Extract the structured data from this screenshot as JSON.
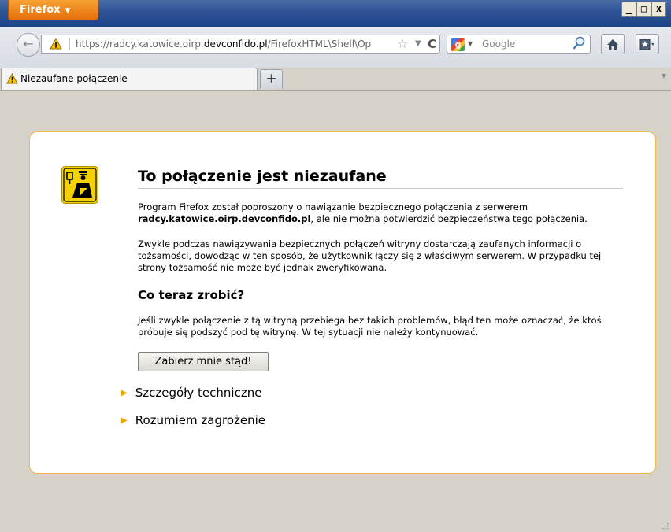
{
  "window": {
    "app_button_label": "Firefox",
    "controls": {
      "minimize": "_",
      "maximize": "□",
      "close": "x"
    }
  },
  "navbar": {
    "url_prefix": "https://radcy.katowice.oirp.",
    "url_host": "devconfido.pl",
    "url_suffix": "/FirefoxHTML\\Shell\\Op",
    "search_engine": "Google",
    "search_placeholder": "Google"
  },
  "tabs": [
    {
      "label": "Niezaufane połączenie",
      "active": true
    }
  ],
  "new_tab_label": "+",
  "error_page": {
    "title": "To połączenie jest niezaufane",
    "intro_before": "Program Firefox został poproszony o nawiązanie bezpiecznego połączenia z serwerem",
    "intro_host": "radcy.katowice.oirp.devconfido.pl",
    "intro_after": ", ale nie można potwierdzić bezpieczeństwa tego połączenia.",
    "explanation": "Zwykle podczas nawiązywania bezpiecznych połączeń witryny dostarczają zaufanych informacji o tożsamości, dowodząc w ten sposób, że użytkownik łączy się z właściwym serwerem. W przypadku tej strony tożsamość nie może być jednak zweryfikowana.",
    "what_to_do_heading": "Co teraz zrobić?",
    "what_to_do_text": "Jeśli zwykle połączenie z tą witryną przebiega bez takich problemów, błąd ten może oznaczać, że ktoś próbuje się podszyć pod tę witrynę. W tej sytuacji nie należy kontynuować.",
    "get_me_out_button": "Zabierz mnie stąd!",
    "technical_details": "Szczegóły techniczne",
    "understand_risks": "Rozumiem zagrożenie"
  },
  "colors": {
    "accent": "#f0a400",
    "box_border": "#f1b849",
    "firefox_button": "#e56f0a"
  }
}
